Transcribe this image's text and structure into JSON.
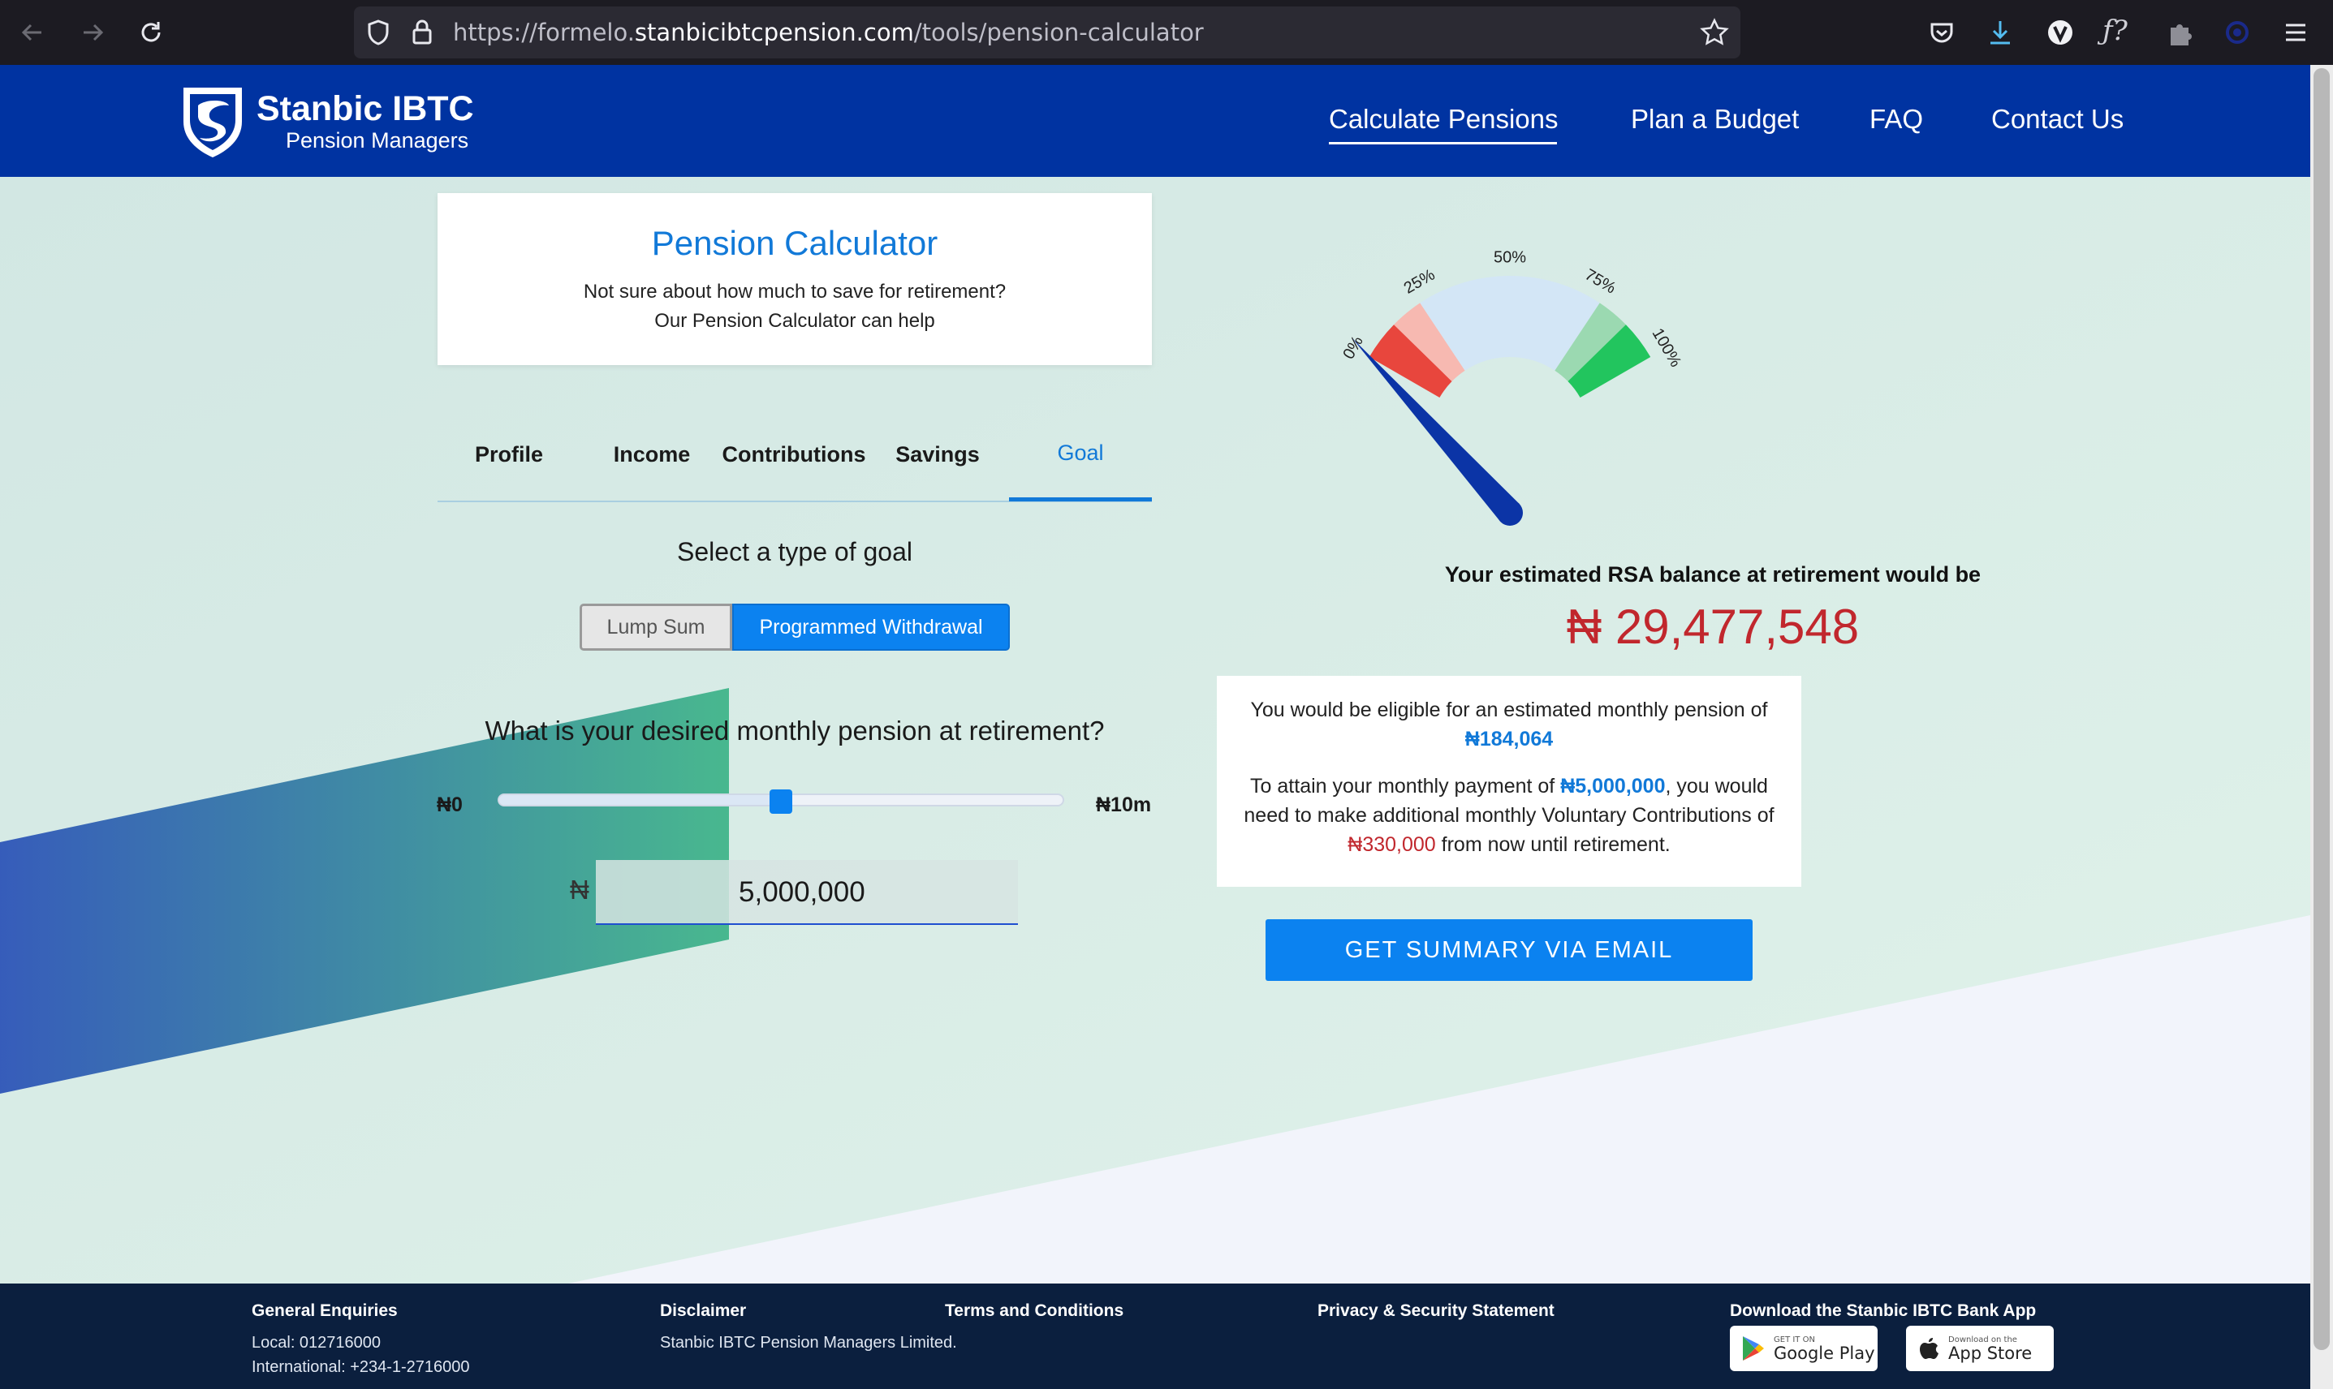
{
  "browser": {
    "url_prefix": "https://formelo.",
    "url_domain": "stanbicibtcpension.com",
    "url_path": "/tools/pension-calculator"
  },
  "brand": {
    "name": "Stanbic IBTC",
    "sub": "Pension Managers"
  },
  "nav": {
    "items": [
      "Calculate Pensions",
      "Plan a Budget",
      "FAQ",
      "Contact Us"
    ]
  },
  "calculator": {
    "title": "Pension Calculator",
    "subtitle_1": "Not sure about how much to save for retirement?",
    "subtitle_2": "Our Pension Calculator can help",
    "tabs": [
      "Profile",
      "Income",
      "Contributions",
      "Savings",
      "Goal"
    ],
    "active_tab": "Goal",
    "goal_type_label": "Select a type of goal",
    "goal_types": [
      "Lump Sum",
      "Programmed Withdrawal"
    ],
    "selected_goal_type": "Programmed Withdrawal",
    "question": "What is your desired monthly pension at retirement?",
    "slider_min_label": "₦0",
    "slider_max_label": "₦10m",
    "slider_value_fraction": 0.5,
    "currency_symbol": "₦",
    "input_value": "5,000,000"
  },
  "gauge": {
    "labels": [
      "0%",
      "25%",
      "50%",
      "75%",
      "100%"
    ],
    "needle_percent": 2
  },
  "result": {
    "label": "Your estimated RSA balance at retirement would be",
    "value": "₦ 29,477,548",
    "eligible_text": "You would be eligible for an estimated monthly pension of",
    "monthly_pension": "₦184,064",
    "attain_pre": "To attain your monthly payment of ",
    "attain_amount": "₦5,000,000",
    "attain_post": ", you would",
    "line3": "need to make additional monthly Voluntary Contributions of",
    "voluntary_amount": "₦330,000",
    "line4_post": " from now until retirement.",
    "email_button": "GET SUMMARY VIA EMAIL"
  },
  "footer": {
    "enquiries_heading": "General Enquiries",
    "local": "Local: 012716000",
    "international": "International: +234-1-2716000",
    "disclaimer_heading": "Disclaimer",
    "disclaimer_text": "Stanbic IBTC Pension Managers Limited.",
    "terms": "Terms and Conditions",
    "privacy": "Privacy & Security Statement",
    "app_heading": "Download the Stanbic IBTC Bank App",
    "google_small": "GET IT ON",
    "google_big": "Google Play",
    "apple_small": "Download on the",
    "apple_big": "App Store"
  },
  "colors": {
    "header_bg": "#0033a1",
    "accent_blue": "#0b82f0",
    "value_red": "#c1272d",
    "footer_bg": "#0b1f3e"
  }
}
